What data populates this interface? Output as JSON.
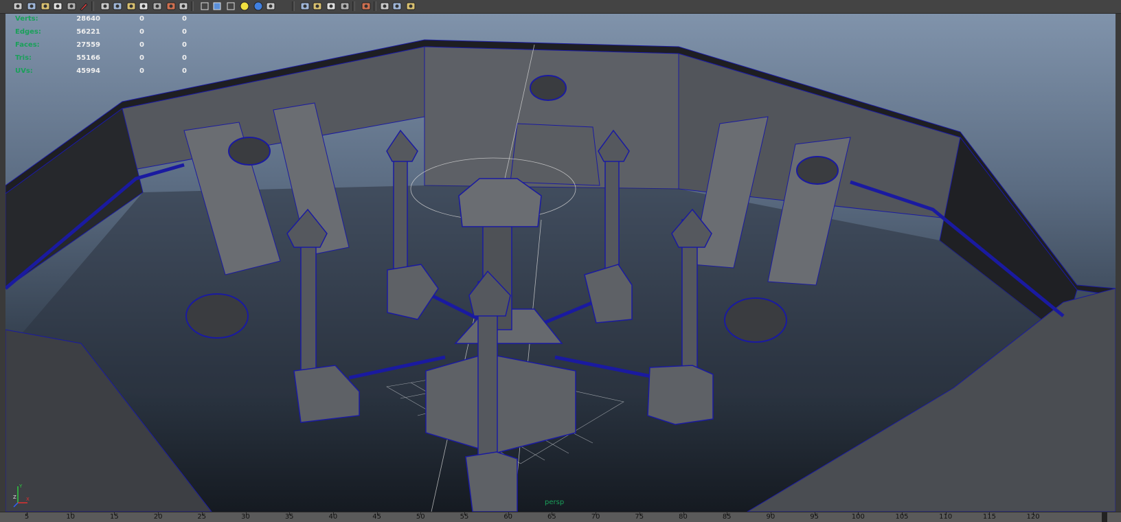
{
  "toolbar": {
    "icons": [
      "camera-attributes-icon",
      "camera-select-icon",
      "bookmark-icon",
      "image-plane-icon",
      "2d-pan-zoom-icon",
      "grease-pencil-icon",
      "grid-toggle-icon",
      "film-gate-icon",
      "resolution-gate-icon",
      "gate-mask-icon",
      "field-chart-icon",
      "safe-action-icon",
      "safe-title-icon",
      "wireframe-icon",
      "smooth-shade-icon",
      "shade-options-icon",
      "textured-icon",
      "use-all-lights-icon",
      "shadows-icon",
      "screen-space-ao-icon",
      "motion-blur-icon",
      "multisample-aa-icon",
      "depth-of-field-icon",
      "isolate-select-icon",
      "xray-icon",
      "xray-joints-icon",
      "xray-components-icon"
    ]
  },
  "hud": {
    "rows": [
      {
        "label": "Verts:",
        "total": "28640",
        "selected": "0",
        "components": "0"
      },
      {
        "label": "Edges:",
        "total": "56221",
        "selected": "0",
        "components": "0"
      },
      {
        "label": "Faces:",
        "total": "27559",
        "selected": "0",
        "components": "0"
      },
      {
        "label": "Tris:",
        "total": "55166",
        "selected": "0",
        "components": "0"
      },
      {
        "label": "UVs:",
        "total": "45994",
        "selected": "0",
        "components": "0"
      }
    ]
  },
  "viewport": {
    "camera": "persp"
  },
  "axis": {
    "x": "X",
    "y": "Y",
    "z": "Z"
  },
  "timeline": {
    "ticks": [
      "5",
      "10",
      "15",
      "20",
      "25",
      "30",
      "35",
      "40",
      "45",
      "50",
      "55",
      "60",
      "65",
      "70",
      "75",
      "80",
      "85",
      "90",
      "95",
      "100",
      "105",
      "110",
      "115",
      "120"
    ]
  },
  "colors": {
    "hud_label": "#1aa05a",
    "hud_value": "#f0f0f0",
    "wireframe": "#1a1aa0",
    "mesh_face": "#5a5d62",
    "viewport_top": "#8093ab",
    "viewport_bottom": "#151a21"
  }
}
